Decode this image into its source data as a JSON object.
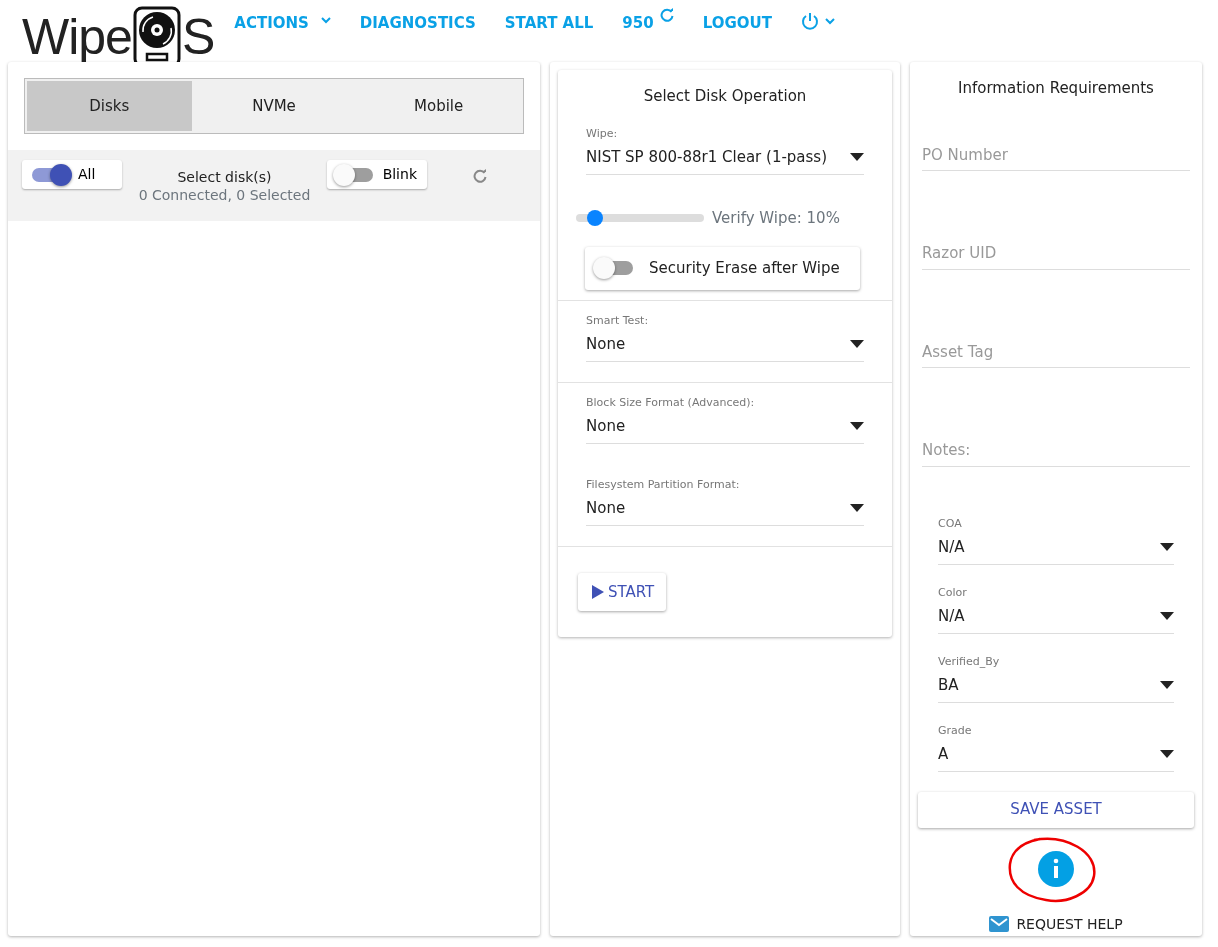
{
  "navbar": {
    "logo": {
      "text_start": "Wipe",
      "text_end": "S"
    },
    "items": [
      {
        "kind": "dropdown",
        "label": "ACTIONS"
      },
      {
        "kind": "link",
        "label": "DIAGNOSTICS"
      },
      {
        "kind": "link",
        "label": "START ALL"
      },
      {
        "kind": "refresh",
        "label": "950"
      },
      {
        "kind": "link",
        "label": "LOGOUT"
      },
      {
        "kind": "power"
      }
    ]
  },
  "disks_panel": {
    "tabs": [
      {
        "label": "Disks",
        "selected": true
      },
      {
        "label": "NVMe",
        "selected": false
      },
      {
        "label": "Mobile",
        "selected": false
      }
    ],
    "all_toggle": {
      "label": "All",
      "on": true
    },
    "title": "Select disk(s)",
    "counts": "0 Connected, 0 Selected",
    "blink_toggle": {
      "label": "Blink",
      "on": false
    }
  },
  "operation_panel": {
    "title": "Select Disk Operation",
    "wipe": {
      "label": "Wipe:",
      "value": "NIST SP 800-88r1 Clear (1-pass)"
    },
    "verify": {
      "level": 0.1,
      "reading": "Verify Wipe: 10%"
    },
    "security_erase": {
      "label": "Security Erase after Wipe",
      "on": false
    },
    "selects": [
      {
        "label": "Smart Test:",
        "value": "None",
        "divider": true
      },
      {
        "label": "Block Size Format (Advanced):",
        "value": "None",
        "divider": true
      },
      {
        "label": "Filesystem Partition Format:",
        "value": "None",
        "divider": false
      }
    ],
    "start_button": "START"
  },
  "info_panel": {
    "title": "Information Requirements",
    "fields": [
      {
        "placeholder": "PO Number"
      },
      {
        "placeholder": "Razor UID"
      },
      {
        "placeholder": "Asset Tag"
      },
      {
        "placeholder": "Notes:"
      }
    ],
    "selects": [
      {
        "label": "COA",
        "value": "N/A"
      },
      {
        "label": "Color",
        "value": "N/A"
      },
      {
        "label": "Verified_By",
        "value": "BA"
      },
      {
        "label": "Grade",
        "value": "A"
      }
    ],
    "save_button": "SAVE ASSET",
    "info_circled": true,
    "request_help": "REQUEST HELP"
  }
}
